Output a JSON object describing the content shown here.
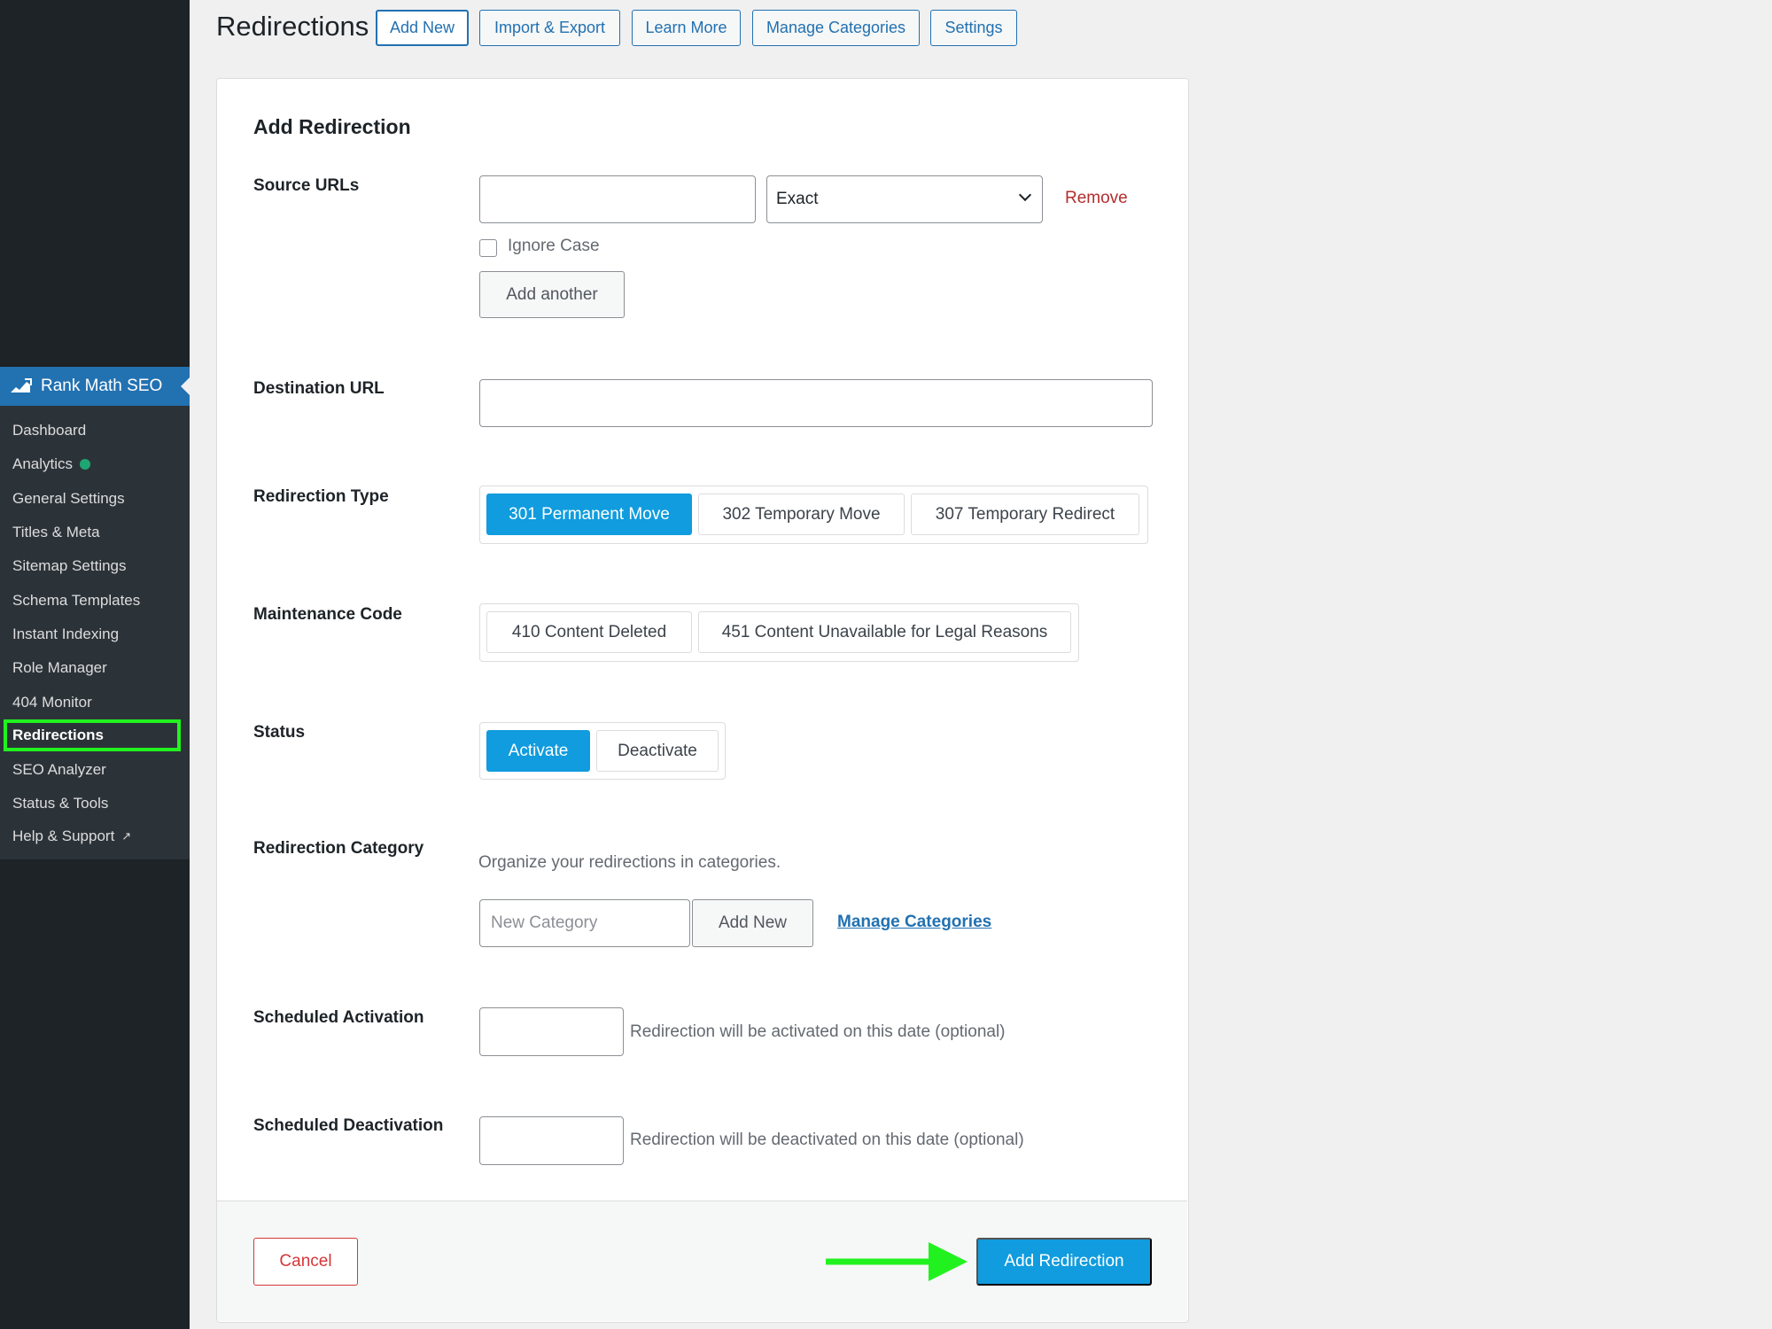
{
  "page": {
    "title": "Redirections",
    "top_buttons": [
      "Add New",
      "Import & Export",
      "Learn More",
      "Manage Categories",
      "Settings"
    ]
  },
  "sidebar": {
    "plugin_name": "Rank Math SEO",
    "items": [
      {
        "label": "Dashboard"
      },
      {
        "label": "Analytics"
      },
      {
        "label": "General Settings"
      },
      {
        "label": "Titles & Meta"
      },
      {
        "label": "Sitemap Settings"
      },
      {
        "label": "Schema Templates"
      },
      {
        "label": "Instant Indexing"
      },
      {
        "label": "Role Manager"
      },
      {
        "label": "404 Monitor"
      },
      {
        "label": "Redirections"
      },
      {
        "label": "SEO Analyzer"
      },
      {
        "label": "Status & Tools"
      },
      {
        "label": "Help & Support"
      }
    ],
    "current_item": "Redirections",
    "highlight_color": "#21f21f"
  },
  "form": {
    "title": "Add Redirection",
    "source_urls": {
      "label": "Source URLs",
      "value": "",
      "match_type": "Exact",
      "remove_label": "Remove",
      "ignore_case_label": "Ignore Case",
      "ignore_case_checked": false,
      "add_another_label": "Add another"
    },
    "destination_url": {
      "label": "Destination URL",
      "value": ""
    },
    "redirection_type": {
      "label": "Redirection Type",
      "options": [
        "301 Permanent Move",
        "302 Temporary Move",
        "307 Temporary Redirect"
      ],
      "selected": "301 Permanent Move"
    },
    "maintenance_code": {
      "label": "Maintenance Code",
      "options": [
        "410 Content Deleted",
        "451 Content Unavailable for Legal Reasons"
      ]
    },
    "status": {
      "label": "Status",
      "options": [
        "Activate",
        "Deactivate"
      ],
      "selected": "Activate"
    },
    "category": {
      "label": "Redirection Category",
      "description": "Organize your redirections in categories.",
      "new_category_placeholder": "New Category",
      "add_new_label": "Add New",
      "manage_link": "Manage Categories"
    },
    "scheduled_activation": {
      "label": "Scheduled Activation",
      "value": "",
      "help": "Redirection will be activated on this date (optional)"
    },
    "scheduled_deactivation": {
      "label": "Scheduled Deactivation",
      "value": "",
      "help": "Redirection will be deactivated on this date (optional)"
    },
    "cancel_label": "Cancel",
    "submit_label": "Add Redirection"
  },
  "colors": {
    "accent": "#109cde",
    "link": "#2271b1",
    "danger": "#d63638",
    "annotation_arrow": "#21f21f"
  }
}
